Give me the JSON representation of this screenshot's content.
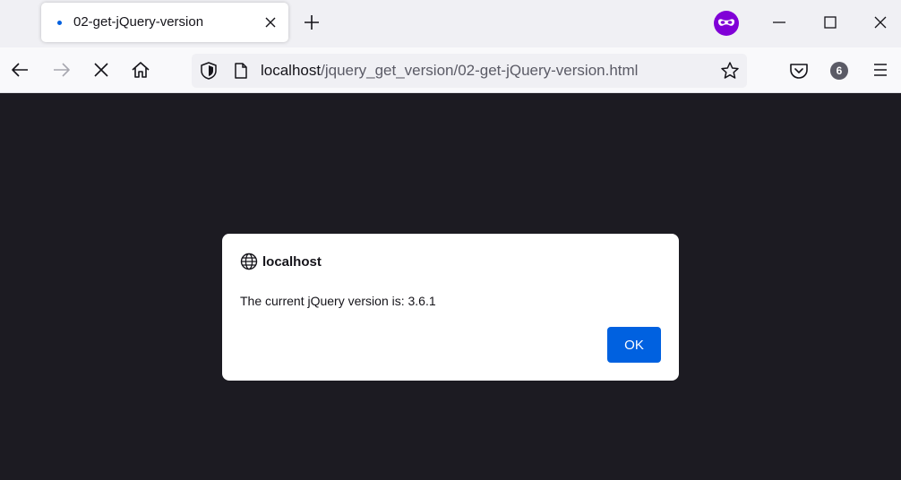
{
  "browser": {
    "tab": {
      "title": "02-get-jQuery-version"
    },
    "url": {
      "host": "localhost",
      "path": "/jquery_get_version/02-get-jQuery-version.html"
    },
    "extensions_badge": "6",
    "colors": {
      "accent": "#0061e0",
      "private": "#8000d7",
      "content_bg": "#1c1b22"
    }
  },
  "dialog": {
    "origin": "localhost",
    "message": "The current jQuery version is: 3.6.1",
    "ok_label": "OK"
  }
}
